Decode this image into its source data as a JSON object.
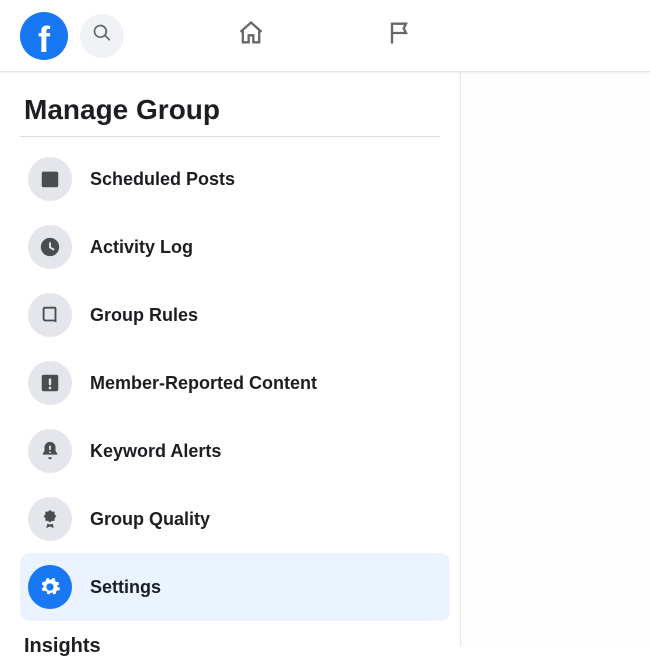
{
  "header": {
    "logo_letter": "f"
  },
  "sidebar": {
    "section_title": "Manage Group",
    "insights_title": "Insights",
    "items": [
      {
        "label": "Scheduled Posts",
        "icon": "calendar",
        "active": false
      },
      {
        "label": "Activity Log",
        "icon": "clock",
        "active": false
      },
      {
        "label": "Group Rules",
        "icon": "book",
        "active": false
      },
      {
        "label": "Member-Reported Content",
        "icon": "alert-square",
        "active": false
      },
      {
        "label": "Keyword Alerts",
        "icon": "alert-bell",
        "active": false
      },
      {
        "label": "Group Quality",
        "icon": "ribbon",
        "active": false
      },
      {
        "label": "Settings",
        "icon": "gear",
        "active": true
      }
    ]
  },
  "colors": {
    "brand": "#1877f2",
    "icon_bg": "#e4e6eb",
    "active_bg": "#eaf3ff"
  }
}
